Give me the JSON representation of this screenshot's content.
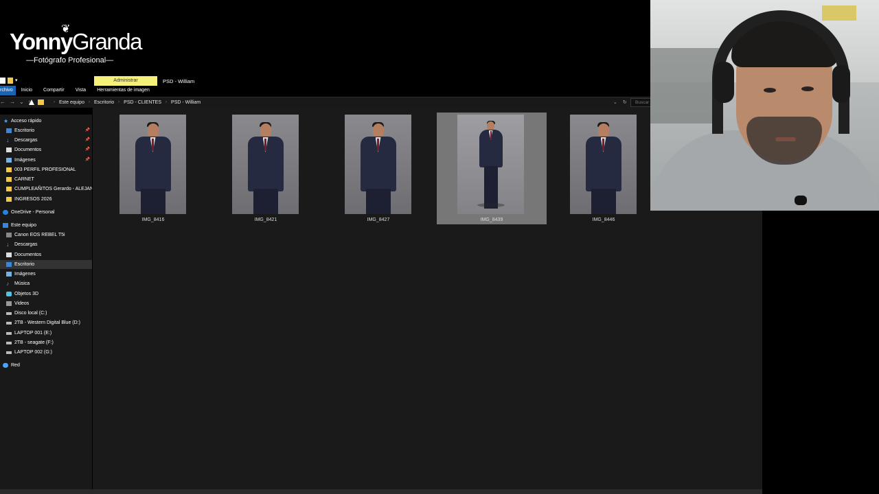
{
  "logo": {
    "brand_bold": "Yonny",
    "brand_light": "Granda",
    "tagline": "—Fotógrafo Profesional—"
  },
  "ribbon": {
    "manage_tab": "Administrar",
    "window_title": "PSD - William",
    "tabs": [
      "rchivo",
      "Inicio",
      "Compartir",
      "Vista",
      "Herramientas de imagen"
    ]
  },
  "address": {
    "crumbs": [
      "Este equipo",
      "Escritorio",
      "PSD - CLIENTES",
      "PSD - William"
    ],
    "search_placeholder": "Buscar"
  },
  "sidebar": {
    "items": [
      {
        "label": "Acceso rápido",
        "icon": "star-icon"
      },
      {
        "label": "Escritorio",
        "icon": "desktop-icon",
        "pinned": true
      },
      {
        "label": "Descargas",
        "icon": "download-icon",
        "pinned": true
      },
      {
        "label": "Documentos",
        "icon": "documents-icon",
        "pinned": true
      },
      {
        "label": "Imágenes",
        "icon": "pictures-icon",
        "pinned": true
      },
      {
        "label": "003 PERFIL PROFESIONAL",
        "icon": "folder-icon"
      },
      {
        "label": "CARNET",
        "icon": "folder-icon"
      },
      {
        "label": "CUMPLEAÑITOS Gerardo - ALEJANDRA",
        "icon": "folder-icon"
      },
      {
        "label": "INGRESOS 2026",
        "icon": "folder-icon"
      },
      {
        "label": "OneDrive - Personal",
        "icon": "cloud-icon"
      },
      {
        "label": "Este equipo",
        "icon": "pc-icon"
      },
      {
        "label": "Canon EOS REBEL T5i",
        "icon": "camera-icon"
      },
      {
        "label": "Descargas",
        "icon": "download-icon"
      },
      {
        "label": "Documentos",
        "icon": "documents-icon"
      },
      {
        "label": "Escritorio",
        "icon": "desktop-icon",
        "selected": true
      },
      {
        "label": "Imágenes",
        "icon": "pictures-icon"
      },
      {
        "label": "Música",
        "icon": "music-icon"
      },
      {
        "label": "Objetos 3D",
        "icon": "objects-3d-icon"
      },
      {
        "label": "Videos",
        "icon": "video-icon"
      },
      {
        "label": "Disco local (C:)",
        "icon": "drive-icon"
      },
      {
        "label": "2TB - Western Digital Blue (D:)",
        "icon": "drive-icon"
      },
      {
        "label": "LAPTOP 001 (E:)",
        "icon": "drive-icon"
      },
      {
        "label": "2TB - seagate (F:)",
        "icon": "drive-icon"
      },
      {
        "label": "LAPTOP 002 (G:)",
        "icon": "drive-icon"
      },
      {
        "label": "Red",
        "icon": "network-icon"
      }
    ]
  },
  "files": [
    {
      "name": "IMG_8416"
    },
    {
      "name": "IMG_8421"
    },
    {
      "name": "IMG_8427"
    },
    {
      "name": "IMG_8439",
      "selected": true
    },
    {
      "name": "IMG_8446"
    }
  ]
}
